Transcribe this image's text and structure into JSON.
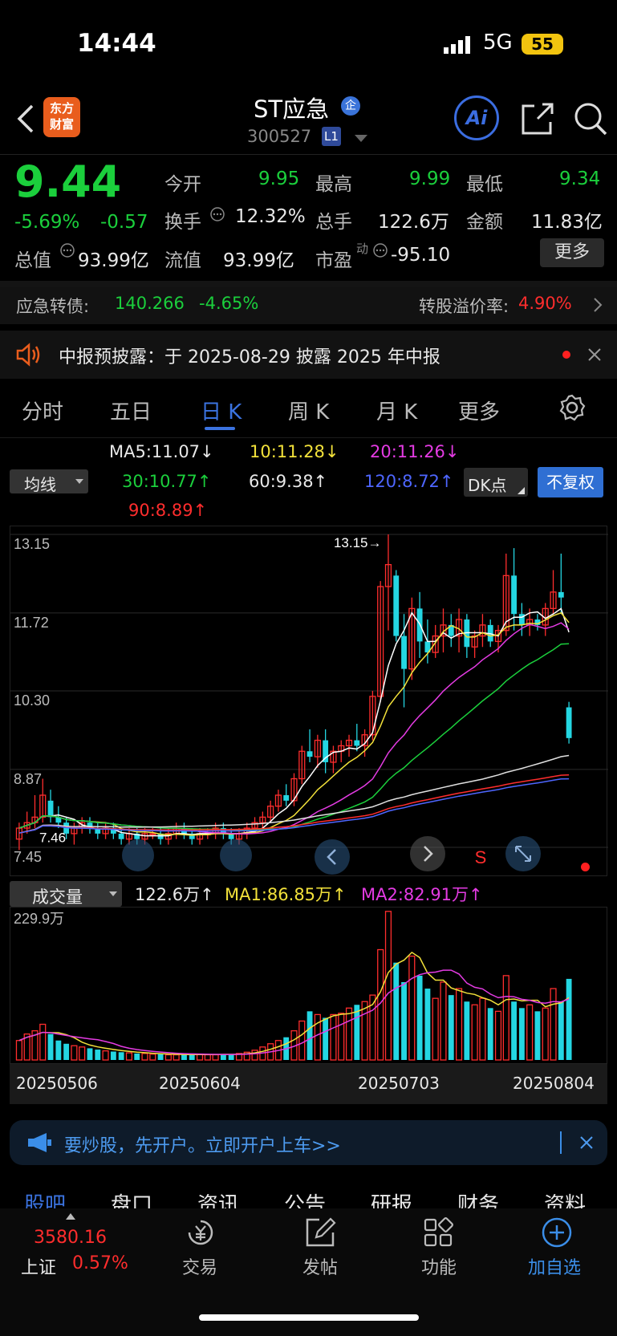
{
  "status_bar": {
    "time": "14:44",
    "network": "5G",
    "battery": "55"
  },
  "header": {
    "logo_text": "东方\n财富",
    "stock_name": "ST应急",
    "badge": "企",
    "code": "300527",
    "level": "L1",
    "ai_label": "Ai"
  },
  "quote": {
    "price": "9.44",
    "change_pct": "-5.69%",
    "change": "-0.57",
    "open_label": "今开",
    "open": "9.95",
    "high_label": "最高",
    "high": "9.99",
    "low_label": "最低",
    "low": "9.34",
    "turnover_label": "换手",
    "turnover": "12.32%",
    "volume_label": "总手",
    "volume": "122.6万",
    "amount_label": "金额",
    "amount": "11.83亿",
    "mktcap_label": "总值",
    "mktcap": "93.99亿",
    "float_label": "流值",
    "float": "93.99亿",
    "pe_label": "市盈",
    "pe_sup": "动",
    "pe": "-95.10",
    "more_label": "更多"
  },
  "bond": {
    "label": "应急转债:",
    "price": "140.266",
    "change": "-4.65%",
    "premium_label": "转股溢价率:",
    "premium": "4.90%"
  },
  "notice": {
    "text": "中报预披露：于 2025-08-29 披露 2025 年中报"
  },
  "tabs": [
    "分时",
    "五日",
    "日 K",
    "周 K",
    "月 K",
    "更多"
  ],
  "active_tab": "日 K",
  "ma_panel": {
    "selector": "均线",
    "ma5": "MA5:11.07↓",
    "ma10": "10:11.28↓",
    "ma20": "20:11.26↓",
    "ma30": "30:10.77↑",
    "ma60": "60:9.38↑",
    "ma120": "120:8.72↑",
    "ma90": "90:8.89↑",
    "dk_button": "DK点",
    "fq_button": "不复权"
  },
  "chart_data": {
    "type": "candlestick",
    "y_ticks": [
      "13.15",
      "11.72",
      "10.30",
      "8.87",
      "7.45"
    ],
    "ylim": [
      7.45,
      13.15
    ],
    "max_label": "13.15→",
    "min_label": "7.46",
    "signal": "S",
    "candles": [
      [
        7.6,
        7.9,
        7.4,
        7.8
      ],
      [
        7.8,
        8.1,
        7.7,
        7.9
      ],
      [
        7.9,
        8.4,
        7.8,
        8.0
      ],
      [
        8.0,
        8.7,
        7.9,
        8.4
      ],
      [
        8.3,
        8.5,
        7.9,
        8.0
      ],
      [
        8.0,
        8.2,
        7.8,
        7.9
      ],
      [
        7.9,
        8.0,
        7.6,
        7.7
      ],
      [
        7.7,
        7.9,
        7.5,
        7.8
      ],
      [
        7.8,
        8.0,
        7.7,
        7.9
      ],
      [
        7.9,
        8.0,
        7.7,
        7.8
      ],
      [
        7.8,
        7.9,
        7.6,
        7.7
      ],
      [
        7.7,
        7.9,
        7.6,
        7.8
      ],
      [
        7.8,
        7.9,
        7.6,
        7.7
      ],
      [
        7.7,
        7.8,
        7.5,
        7.6
      ],
      [
        7.6,
        7.8,
        7.5,
        7.7
      ],
      [
        7.7,
        7.8,
        7.5,
        7.6
      ],
      [
        7.6,
        7.8,
        7.5,
        7.7
      ],
      [
        7.7,
        7.8,
        7.6,
        7.7
      ],
      [
        7.7,
        7.8,
        7.5,
        7.6
      ],
      [
        7.6,
        7.8,
        7.5,
        7.7
      ],
      [
        7.7,
        7.9,
        7.6,
        7.8
      ],
      [
        7.8,
        7.9,
        7.6,
        7.7
      ],
      [
        7.7,
        7.8,
        7.5,
        7.6
      ],
      [
        7.6,
        7.8,
        7.5,
        7.7
      ],
      [
        7.7,
        7.8,
        7.6,
        7.7
      ],
      [
        7.7,
        7.9,
        7.6,
        7.8
      ],
      [
        7.8,
        7.9,
        7.6,
        7.7
      ],
      [
        7.7,
        7.8,
        7.5,
        7.6
      ],
      [
        7.6,
        7.8,
        7.5,
        7.7
      ],
      [
        7.7,
        7.9,
        7.6,
        7.8
      ],
      [
        7.8,
        8.0,
        7.7,
        7.9
      ],
      [
        7.9,
        8.1,
        7.8,
        8.0
      ],
      [
        8.0,
        8.3,
        7.9,
        8.2
      ],
      [
        8.2,
        8.5,
        8.1,
        8.4
      ],
      [
        8.4,
        8.6,
        8.2,
        8.3
      ],
      [
        8.3,
        8.8,
        8.2,
        8.7
      ],
      [
        8.7,
        9.3,
        8.6,
        9.2
      ],
      [
        9.2,
        9.6,
        9.0,
        9.1
      ],
      [
        9.1,
        9.5,
        8.9,
        9.4
      ],
      [
        9.4,
        9.6,
        8.8,
        9.0
      ],
      [
        9.0,
        9.3,
        8.8,
        9.2
      ],
      [
        9.2,
        9.4,
        9.0,
        9.3
      ],
      [
        9.3,
        9.5,
        9.1,
        9.4
      ],
      [
        9.4,
        9.7,
        9.2,
        9.3
      ],
      [
        9.3,
        9.6,
        9.1,
        9.5
      ],
      [
        9.5,
        10.3,
        9.4,
        10.2
      ],
      [
        10.2,
        12.3,
        10.1,
        12.2
      ],
      [
        12.2,
        13.15,
        11.4,
        12.6
      ],
      [
        12.4,
        12.5,
        11.2,
        11.3
      ],
      [
        11.3,
        11.7,
        10.0,
        10.7
      ],
      [
        10.7,
        12.0,
        10.5,
        11.8
      ],
      [
        11.8,
        12.1,
        10.9,
        11.2
      ],
      [
        11.2,
        11.6,
        10.8,
        11.0
      ],
      [
        11.0,
        11.5,
        10.9,
        11.3
      ],
      [
        11.3,
        11.8,
        11.0,
        11.5
      ],
      [
        11.5,
        11.7,
        11.1,
        11.3
      ],
      [
        11.3,
        11.8,
        11.0,
        11.6
      ],
      [
        11.6,
        11.7,
        10.9,
        11.1
      ],
      [
        11.1,
        11.4,
        10.9,
        11.3
      ],
      [
        11.3,
        11.7,
        11.1,
        11.5
      ],
      [
        11.5,
        11.6,
        11.1,
        11.2
      ],
      [
        11.2,
        11.5,
        11.0,
        11.4
      ],
      [
        11.4,
        12.8,
        11.3,
        12.4
      ],
      [
        12.4,
        12.9,
        11.4,
        11.7
      ],
      [
        11.7,
        11.9,
        11.3,
        11.5
      ],
      [
        11.5,
        11.8,
        11.3,
        11.6
      ],
      [
        11.6,
        11.7,
        11.4,
        11.5
      ],
      [
        11.5,
        11.9,
        11.3,
        11.8
      ],
      [
        11.8,
        12.5,
        11.7,
        12.1
      ],
      [
        12.1,
        12.8,
        11.7,
        12.0
      ],
      [
        10.0,
        10.1,
        9.34,
        9.44
      ]
    ],
    "volume_ticks": [
      "229.9万"
    ],
    "volumes": [
      30,
      40,
      45,
      55,
      40,
      30,
      25,
      22,
      20,
      18,
      16,
      14,
      13,
      12,
      11,
      10,
      10,
      9,
      9,
      8,
      8,
      8,
      9,
      9,
      8,
      8,
      9,
      9,
      10,
      12,
      15,
      20,
      25,
      30,
      35,
      45,
      60,
      75,
      70,
      65,
      70,
      72,
      80,
      85,
      90,
      100,
      170,
      229,
      150,
      120,
      160,
      130,
      110,
      95,
      120,
      100,
      110,
      90,
      85,
      95,
      80,
      75,
      130,
      90,
      80,
      85,
      75,
      80,
      110,
      90,
      125
    ],
    "date_labels": [
      "20250506",
      "20250604",
      "20250703",
      "20250804"
    ]
  },
  "volume_panel": {
    "selector": "成交量",
    "vol": "122.6万↑",
    "ma1": "MA1:86.85万↑",
    "ma2": "MA2:82.91万↑"
  },
  "promo": {
    "text": "要炒股，先开户。立即开户上车>>"
  },
  "sub_tabs": [
    "股吧",
    "盘口",
    "资讯",
    "公告",
    "研报",
    "财务",
    "资料"
  ],
  "index": {
    "value": "3580.16",
    "name": "上证",
    "change": "0.57%"
  },
  "bottom_nav": [
    {
      "icon": "yuan-icon",
      "label": "交易"
    },
    {
      "icon": "edit-icon",
      "label": "发帖"
    },
    {
      "icon": "grid-icon",
      "label": "功能"
    },
    {
      "icon": "plus-icon",
      "label": "加自选"
    }
  ],
  "colors": {
    "up": "#ff2d2d",
    "down": "#1bcf3c",
    "accent": "#3b73e0",
    "teal": "#24d6e2"
  }
}
